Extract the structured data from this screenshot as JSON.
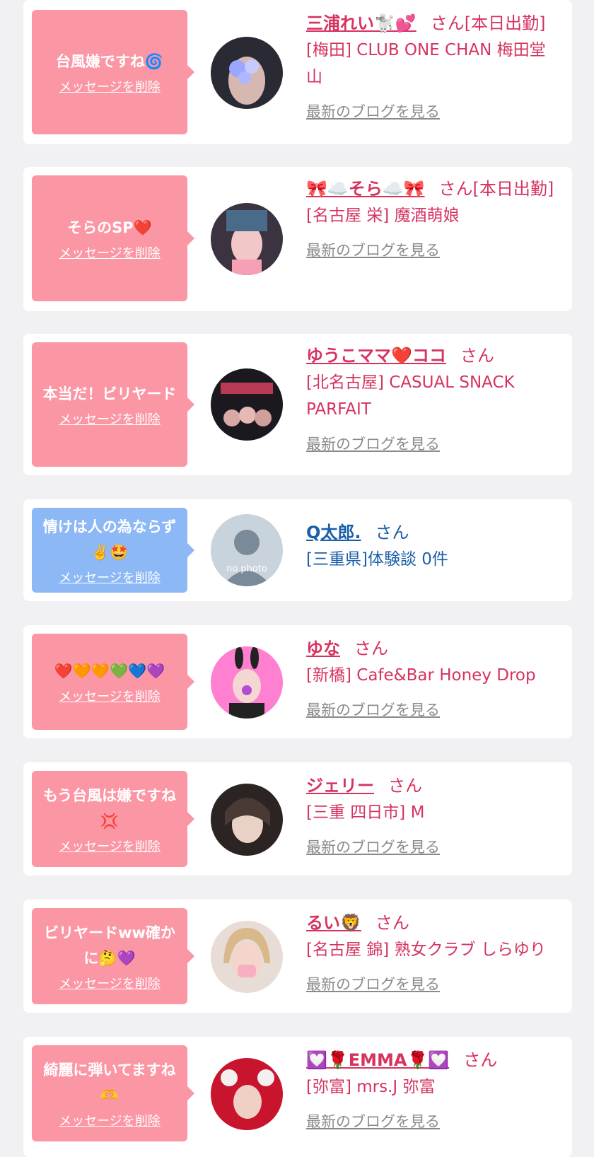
{
  "colors": {
    "accent_pink": "#fb96a5",
    "accent_blue": "#8cb8f5",
    "text_pink": "#d6335f",
    "text_blue": "#1b5fa8",
    "link_gray": "#8a8a8a"
  },
  "labels": {
    "delete": "メッセージを削除",
    "blog": "最新のブログを見る"
  },
  "items": [
    {
      "message": "台風嫌ですね🌀",
      "name": "三浦れい🐩💕",
      "suffix": "さん[本日出勤]",
      "shop": "[梅田] CLUB ONE CHAN 梅田堂山",
      "has_blog": true,
      "avatar_icon": "avatar-photo-icon"
    },
    {
      "message": "そらのSP❤️",
      "name": "🎀☁️そら☁️🎀",
      "suffix": "さん[本日出勤]",
      "shop": "[名古屋 栄] 魔酒萌娘",
      "has_blog": true,
      "avatar_icon": "avatar-photo-icon"
    },
    {
      "message": "本当だ！ビリヤード",
      "name": "ゆうこママ❤️ココ",
      "suffix": "さん",
      "shop": "[北名古屋] CASUAL SNACK PARFAIT",
      "has_blog": true,
      "avatar_icon": "avatar-photo-icon"
    },
    {
      "message": "情けは人の為ならず✌️🤩",
      "name": "Q太郎.",
      "suffix": "さん",
      "shop": "[三重県]体験談 0件",
      "has_blog": false,
      "avatar_icon": "no-photo-icon",
      "avatar_text": "no photo"
    },
    {
      "message": "❤️🧡🧡💚💙💜",
      "name": "ゆな",
      "suffix": "さん",
      "shop": "[新橋] Cafe&Bar Honey Drop",
      "has_blog": true,
      "avatar_icon": "avatar-photo-icon"
    },
    {
      "message": "もう台風は嫌ですね💢",
      "name": "ジェリー",
      "suffix": "さん",
      "shop": "[三重 四日市] M",
      "has_blog": true,
      "avatar_icon": "avatar-photo-icon"
    },
    {
      "message": "ビリヤードww確かに🤔💜",
      "name": "るい🦁",
      "suffix": "さん",
      "shop": "[名古屋 錦] 熟女クラブ しらゆり",
      "has_blog": true,
      "avatar_icon": "avatar-photo-icon"
    },
    {
      "message": "綺麗に弾いてますね🫶",
      "name": "💟🌹EMMA🌹💟",
      "suffix": "さん",
      "shop": "[弥富] mrs.J 弥富",
      "has_blog": true,
      "avatar_icon": "avatar-photo-icon"
    }
  ]
}
